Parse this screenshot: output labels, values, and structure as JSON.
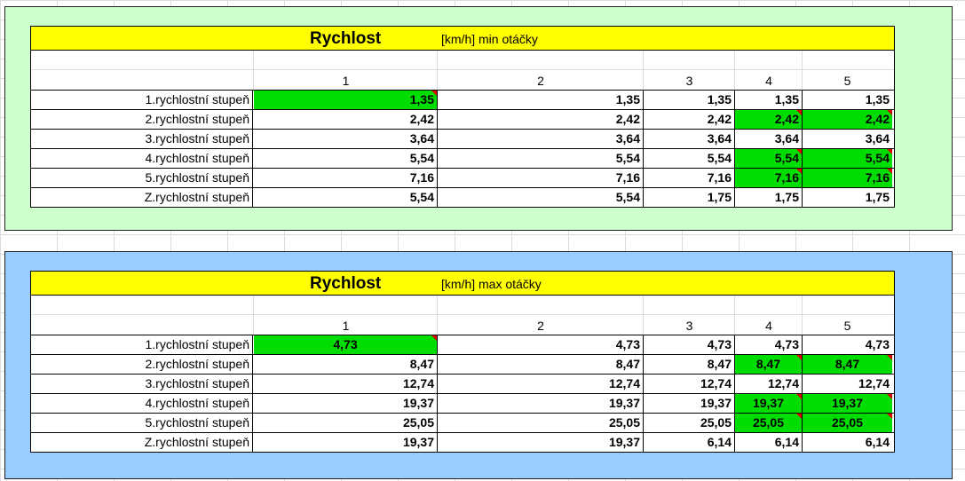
{
  "tables": [
    {
      "title": "Rychlost",
      "subtitle": "[km/h] min otáčky",
      "columns": [
        "1",
        "2",
        "3",
        "4",
        "5"
      ],
      "rows": [
        {
          "label": "1.rychlostní stupeň",
          "values": [
            "1,35",
            "1,35",
            "1,35",
            "1,35",
            "1,35"
          ]
        },
        {
          "label": "2.rychlostní stupeň",
          "values": [
            "2,42",
            "2,42",
            "2,42",
            "2,42",
            "2,42"
          ]
        },
        {
          "label": "3.rychlostní stupeň",
          "values": [
            "3,64",
            "3,64",
            "3,64",
            "3,64",
            "3,64"
          ]
        },
        {
          "label": "4.rychlostní stupeň",
          "values": [
            "5,54",
            "5,54",
            "5,54",
            "5,54",
            "5,54"
          ]
        },
        {
          "label": "5.rychlostní stupeň",
          "values": [
            "7,16",
            "7,16",
            "7,16",
            "7,16",
            "7,16"
          ]
        },
        {
          "label": "Z.rychlostní stupeň",
          "values": [
            "5,54",
            "5,54",
            "1,75",
            "1,75",
            "1,75"
          ]
        }
      ],
      "colors": {
        "panel": "#ccffcc",
        "title_bar": "#ffff00",
        "highlight": "#00dd00"
      }
    },
    {
      "title": "Rychlost",
      "subtitle": "[km/h] max otáčky",
      "columns": [
        "1",
        "2",
        "3",
        "4",
        "5"
      ],
      "rows": [
        {
          "label": "1.rychlostní stupeň",
          "values": [
            "4,73",
            "4,73",
            "4,73",
            "4,73",
            "4,73"
          ]
        },
        {
          "label": "2.rychlostní stupeň",
          "values": [
            "8,47",
            "8,47",
            "8,47",
            "8,47",
            "8,47"
          ]
        },
        {
          "label": "3.rychlostní stupeň",
          "values": [
            "12,74",
            "12,74",
            "12,74",
            "12,74",
            "12,74"
          ]
        },
        {
          "label": "4.rychlostní stupeň",
          "values": [
            "19,37",
            "19,37",
            "19,37",
            "19,37",
            "19,37"
          ]
        },
        {
          "label": "5.rychlostní stupeň",
          "values": [
            "25,05",
            "25,05",
            "25,05",
            "25,05",
            "25,05"
          ]
        },
        {
          "label": "Z.rychlostní stupeň",
          "values": [
            "19,37",
            "19,37",
            "6,14",
            "6,14",
            "6,14"
          ]
        }
      ],
      "colors": {
        "panel": "#99ccff",
        "title_bar": "#ffff00",
        "highlight": "#00dd00"
      }
    }
  ]
}
